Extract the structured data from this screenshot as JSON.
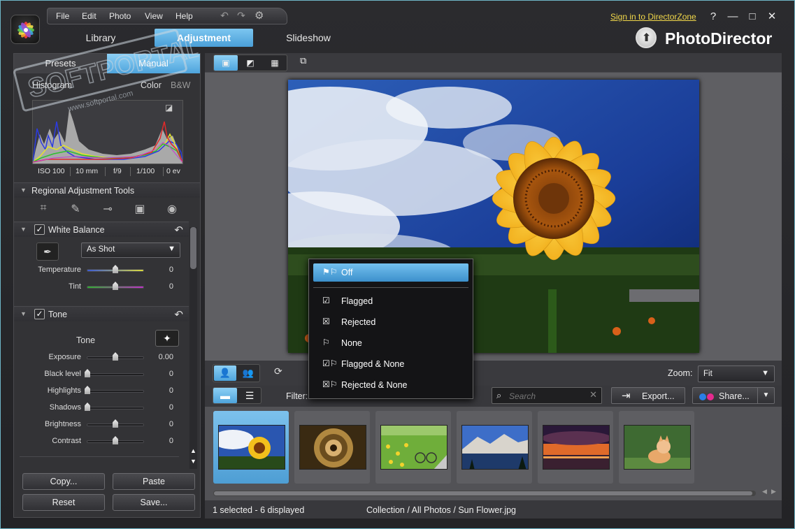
{
  "menu": {
    "items": [
      "File",
      "Edit",
      "Photo",
      "View",
      "Help"
    ]
  },
  "signin": "Sign in to DirectorZone",
  "window_buttons": {
    "help": "?",
    "minimize": "—",
    "maximize": "□",
    "close": "✕"
  },
  "modes": [
    {
      "label": "Library",
      "active": false
    },
    {
      "label": "Adjustment",
      "active": true
    },
    {
      "label": "Slideshow",
      "active": false
    }
  ],
  "brand": "PhotoDirector",
  "watermark": {
    "text": "SOFTPORTAL",
    "url": "www.softportal.com"
  },
  "left": {
    "subtabs": [
      "Presets",
      "Manual"
    ],
    "histogram": {
      "title": "Histogram",
      "modes": [
        "Color",
        "B&W"
      ]
    },
    "exif": [
      "ISO 100",
      "10 mm",
      "f/9",
      "1/100",
      "0 ev"
    ],
    "regional": {
      "title": "Regional Adjustment Tools",
      "tools": [
        "crop-icon",
        "brush-icon",
        "gradient-icon",
        "radial-icon",
        "red-eye-icon"
      ]
    },
    "white_balance": {
      "title": "White Balance",
      "preset": "As Shot",
      "sliders": [
        {
          "label": "Temperature",
          "value": "0",
          "pos": 0.5
        },
        {
          "label": "Tint",
          "value": "0",
          "pos": 0.5
        }
      ]
    },
    "tone": {
      "title": "Tone",
      "label": "Tone",
      "sliders": [
        {
          "label": "Exposure",
          "value": "0.00",
          "pos": 0.5
        },
        {
          "label": "Black level",
          "value": "0",
          "pos": 0.0
        },
        {
          "label": "Highlights",
          "value": "0",
          "pos": 0.0
        },
        {
          "label": "Shadows",
          "value": "0",
          "pos": 0.0
        },
        {
          "label": "Brightness",
          "value": "0",
          "pos": 0.5
        },
        {
          "label": "Contrast",
          "value": "0",
          "pos": 0.5
        }
      ]
    },
    "buttons": {
      "copy": "Copy...",
      "paste": "Paste",
      "reset": "Reset",
      "save": "Save..."
    }
  },
  "viewer": {
    "zoom_label": "Zoom:",
    "zoom_value": "Fit"
  },
  "filter": {
    "label": "Filter:",
    "search_placeholder": "Search",
    "export": "Export...",
    "share": "Share..."
  },
  "flag_menu": {
    "items": [
      {
        "label": "Off",
        "icon": "flag-off-icon",
        "active": true
      },
      {
        "label": "Flagged",
        "icon": "flagged-icon",
        "active": false
      },
      {
        "label": "Rejected",
        "icon": "rejected-icon",
        "active": false
      },
      {
        "label": "None",
        "icon": "none-flag-icon",
        "active": false
      },
      {
        "label": "Flagged & None",
        "icon": "flagged-none-icon",
        "active": false
      },
      {
        "label": "Rejected & None",
        "icon": "rejected-none-icon",
        "active": false
      }
    ]
  },
  "thumbnails": [
    {
      "name": "sunflower",
      "selected": true
    },
    {
      "name": "spiral-staircase",
      "selected": false
    },
    {
      "name": "bicycle-field",
      "selected": false
    },
    {
      "name": "mountain-lake",
      "selected": false
    },
    {
      "name": "sunset",
      "selected": false
    },
    {
      "name": "cat",
      "selected": false
    }
  ],
  "status": {
    "selection": "1 selected - 6 displayed",
    "path": "Collection / All Photos / Sun Flower.jpg"
  },
  "colors": {
    "accent": "#4ea4dc",
    "signin": "#f2d84a",
    "panel": "#333336"
  }
}
